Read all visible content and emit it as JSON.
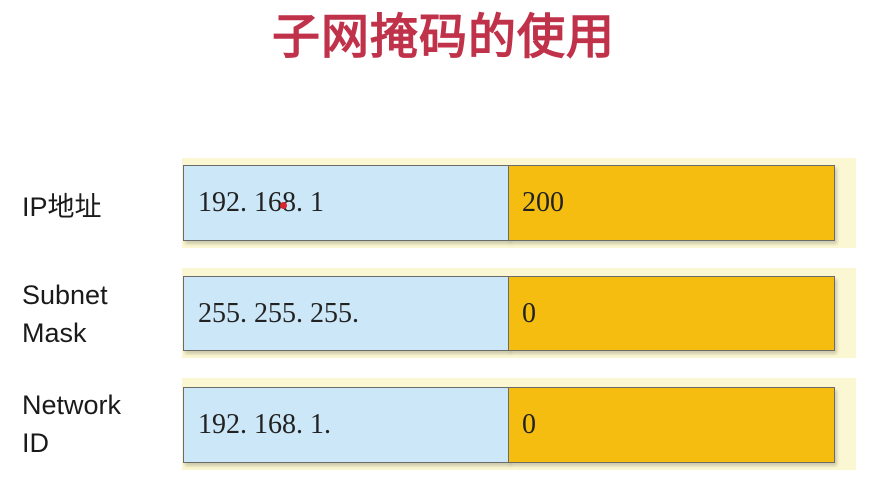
{
  "title": "子网掩码的使用",
  "colors": {
    "title": "#c0314a",
    "network_part": "#cce8f8",
    "host_part": "#f5bd0f",
    "backdrop": "#fbf7d2"
  },
  "rows": [
    {
      "label": "IP地址",
      "network_part": "192. 168. 1",
      "host_part": "200"
    },
    {
      "label": "Subnet\nMask",
      "network_part": "255. 255. 255.",
      "host_part": "0"
    },
    {
      "label": "Network\nID",
      "network_part": "192. 168. 1.",
      "host_part": "0"
    }
  ]
}
